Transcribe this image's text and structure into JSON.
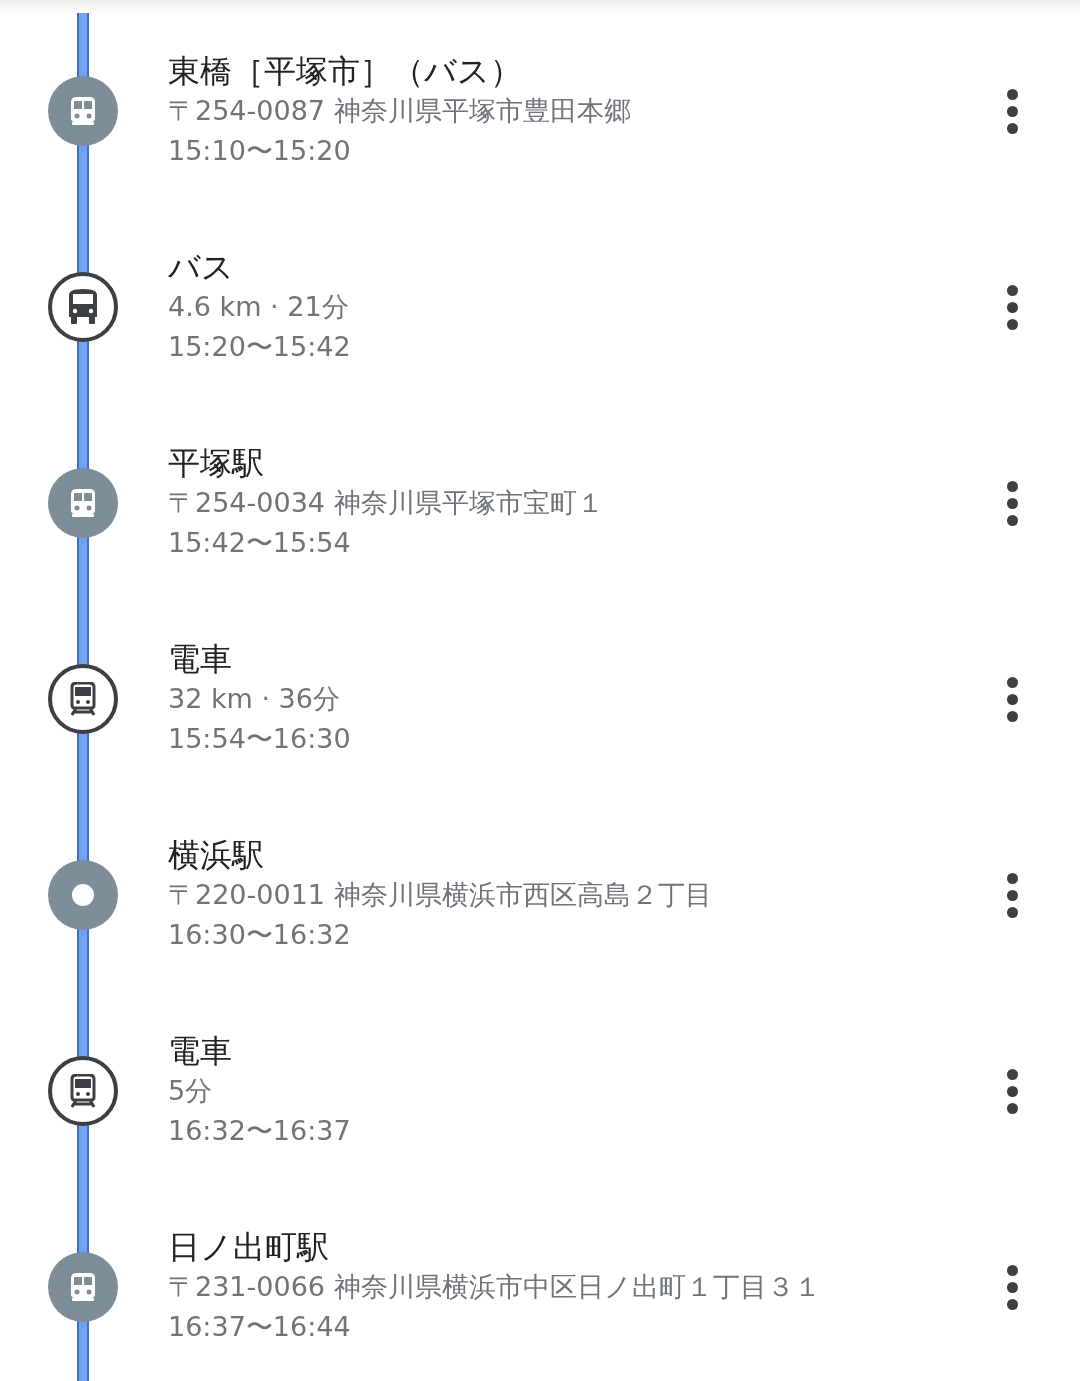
{
  "timeline": [
    {
      "kind": "station",
      "title": "東橋［平塚市］（バス）",
      "subtitle": "〒254-0087 神奈川県平塚市豊田本郷",
      "time": "15:10〜15:20"
    },
    {
      "kind": "bus",
      "title": "バス",
      "subtitle": "4.6 km · 21分",
      "time": "15:20〜15:42"
    },
    {
      "kind": "station",
      "title": "平塚駅",
      "subtitle": "〒254-0034 神奈川県平塚市宝町１",
      "time": "15:42〜15:54"
    },
    {
      "kind": "train",
      "title": "電車",
      "subtitle": "32 km · 36分",
      "time": "15:54〜16:30"
    },
    {
      "kind": "stop",
      "title": "横浜駅",
      "subtitle": "〒220-0011 神奈川県横浜市西区高島２丁目",
      "time": "16:30〜16:32"
    },
    {
      "kind": "train",
      "title": "電車",
      "subtitle": "5分",
      "time": "16:32〜16:37"
    },
    {
      "kind": "station",
      "title": "日ノ出町駅",
      "subtitle": "〒231-0066 神奈川県横浜市中区日ノ出町１丁目３１",
      "time": "16:37〜16:44"
    }
  ]
}
